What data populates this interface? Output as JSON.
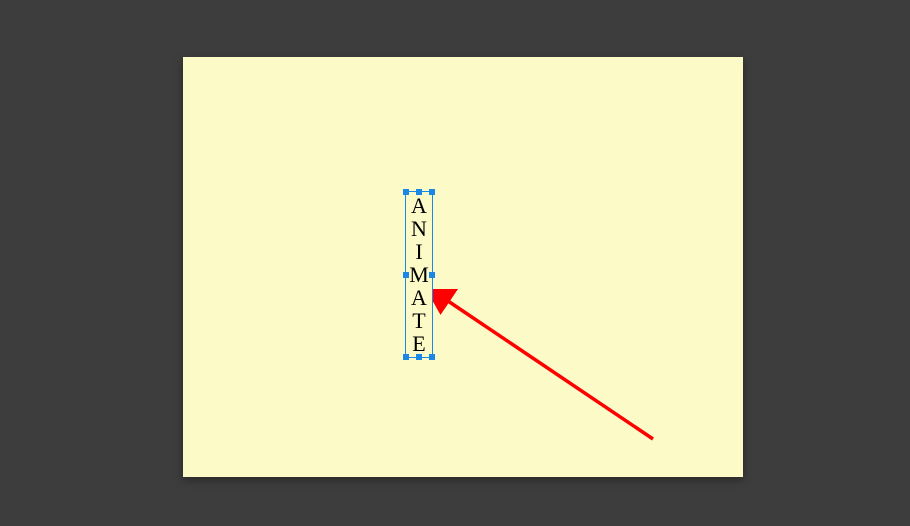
{
  "canvas": {
    "background_color": "#fcfac7"
  },
  "text_box": {
    "letters": [
      "A",
      "N",
      "I",
      "M",
      "A",
      "T",
      "E"
    ]
  },
  "annotation": {
    "type": "arrow",
    "color": "#ff0000"
  },
  "colors": {
    "workspace_bg": "#3d3d3d",
    "selection": "#1b88e6",
    "arrow": "#ff0000"
  }
}
